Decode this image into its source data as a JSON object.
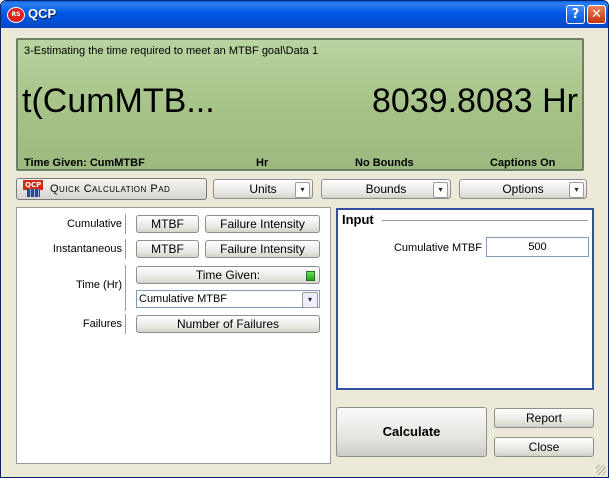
{
  "window": {
    "title": "QCP",
    "help_label": "?",
    "close_label": "✕",
    "logo_text": "RS"
  },
  "display": {
    "path": "3-Estimating the time required to meet an MTBF goal\\Data 1",
    "label": "t(CumMTB...",
    "value": "8039.8083 Hr",
    "status": {
      "time_given": "Time Given: CumMTBF",
      "units": "Hr",
      "bounds": "No Bounds",
      "captions": "Captions On"
    }
  },
  "toolbar": {
    "qcp_logo": "QCP",
    "pad_label": "Quick Calculation Pad",
    "units_label": "Units",
    "bounds_label": "Bounds",
    "options_label": "Options",
    "dropdown_glyph": "▾"
  },
  "calc_panel": {
    "cumulative_label": "Cumulative",
    "cumulative_mtbf": "MTBF",
    "cumulative_fi": "Failure Intensity",
    "instantaneous_label": "Instantaneous",
    "instantaneous_mtbf": "MTBF",
    "instantaneous_fi": "Failure Intensity",
    "time_label": "Time (Hr)",
    "time_given_button": "Time Given:",
    "time_given_select": "Cumulative MTBF",
    "failures_label": "Failures",
    "failures_button": "Number of Failures"
  },
  "input_panel": {
    "legend": "Input",
    "field_label": "Cumulative MTBF",
    "field_value": "500"
  },
  "actions": {
    "calculate": "Calculate",
    "report": "Report",
    "close": "Close"
  }
}
